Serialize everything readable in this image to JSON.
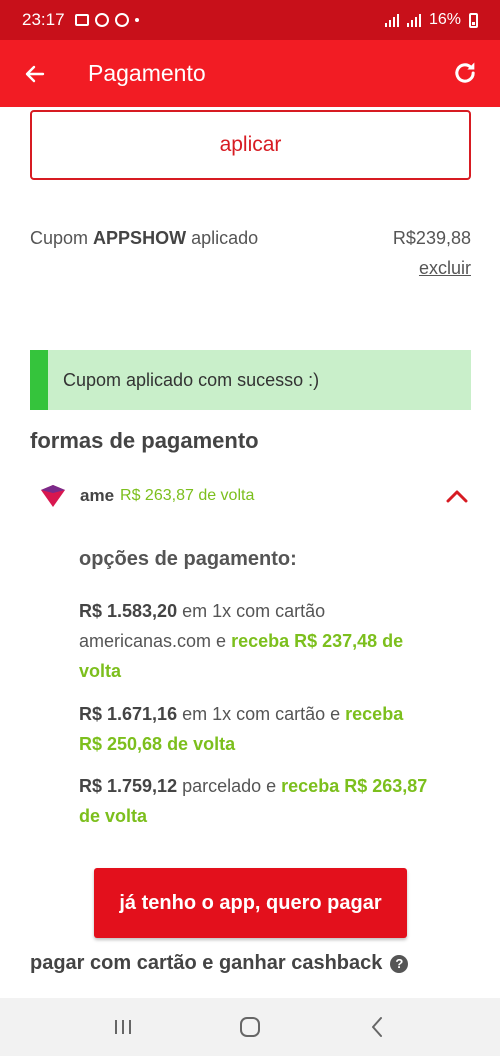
{
  "status_bar": {
    "time": "23:17",
    "battery": "16%"
  },
  "app_bar": {
    "title": "Pagamento"
  },
  "coupon": {
    "apply_label": "aplicar",
    "prefix": "Cupom",
    "code": "APPSHOW",
    "suffix": "aplicado",
    "amount": "R$239,88",
    "remove_label": "excluir",
    "success_message": "Cupom aplicado com sucesso :)"
  },
  "payment": {
    "section_title": "formas de pagamento",
    "method_name": "ame",
    "method_cashback": "R$ 263,87 de volta",
    "options_title": "opções de pagamento:",
    "options": [
      {
        "price": "R$ 1.583,20",
        "text": " em 1x com cartão americanas.com e ",
        "cashback": "receba R$ 237,48 de volta"
      },
      {
        "price": "R$ 1.671,16",
        "text": " em 1x com cartão e ",
        "cashback": "receba R$ 250,68 de volta"
      },
      {
        "price": "R$ 1.759,12",
        "text": " parcelado e ",
        "cashback": "receba R$ 263,87 de volta"
      }
    ],
    "pay_button_label": "já tenho o app, quero pagar",
    "card_cashback_title": "pagar com cartão e ganhar cashback",
    "help_glyph": "?"
  },
  "colors": {
    "brand_red": "#f21c24",
    "status_red": "#c8101a",
    "cashback_green": "#7cbf1d",
    "success_bg": "#c9efca",
    "success_bar": "#35c43c"
  },
  "icons": [
    "back-arrow-icon",
    "refresh-icon",
    "ame-logo-icon",
    "chevron-up-icon",
    "help-icon",
    "recents-icon",
    "home-icon",
    "back-nav-icon"
  ]
}
